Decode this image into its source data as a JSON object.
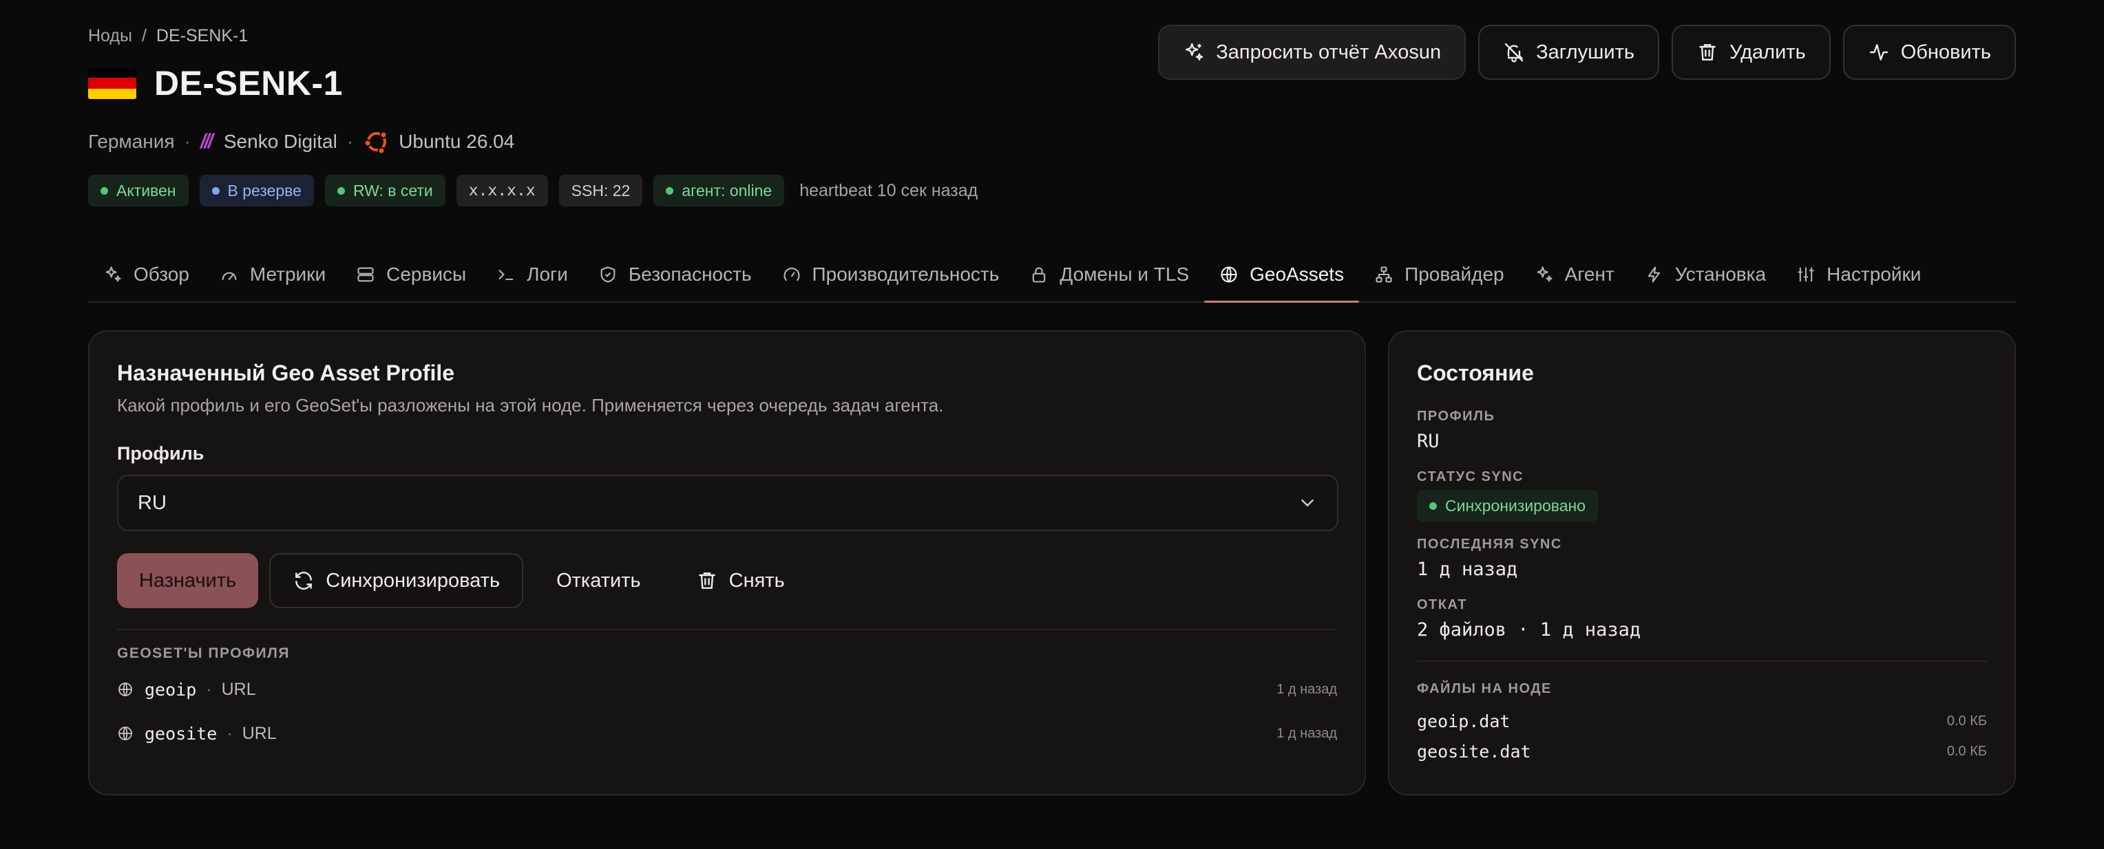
{
  "breadcrumb": {
    "root": "Ноды",
    "separator": "/",
    "current": "DE-SENK-1"
  },
  "node": {
    "title": "DE-SENK-1",
    "flag_colors": [
      "#000000",
      "#dd0000",
      "#ffce00"
    ],
    "country": "Германия",
    "provider_logo": "///",
    "provider": "Senko Digital",
    "os": "Ubuntu 26.04"
  },
  "badges": [
    {
      "label": "Активен",
      "led": "#59c37c"
    },
    {
      "label": "В резерве",
      "led": "#7ea6f5"
    },
    {
      "label": "RW: в сети",
      "led": "#59c37c"
    },
    {
      "label": "x.x.x.x"
    },
    {
      "label": "SSH: 22"
    },
    {
      "label": "агент: online",
      "led": "#59c37c"
    }
  ],
  "heartbeat": "heartbeat 10 сек назад",
  "actions": {
    "request_report": "Запросить отчёт Axosun",
    "mute": "Заглушить",
    "delete": "Удалить",
    "refresh": "Обновить"
  },
  "tabs": [
    {
      "label": "Обзор",
      "icon": "sparkles-icon"
    },
    {
      "label": "Метрики",
      "icon": "gauge-icon"
    },
    {
      "label": "Сервисы",
      "icon": "server-icon"
    },
    {
      "label": "Логи",
      "icon": "terminal-icon"
    },
    {
      "label": "Безопасность",
      "icon": "shield-icon"
    },
    {
      "label": "Производительность",
      "icon": "speedometer-icon"
    },
    {
      "label": "Домены и TLS",
      "icon": "lock-icon"
    },
    {
      "label": "GeoAssets",
      "icon": "globe-icon",
      "active": true
    },
    {
      "label": "Провайдер",
      "icon": "network-icon"
    },
    {
      "label": "Агент",
      "icon": "sparkles-icon"
    },
    {
      "label": "Установка",
      "icon": "bolt-icon"
    },
    {
      "label": "Настройки",
      "icon": "sliders-icon"
    }
  ],
  "profile_card": {
    "title": "Назначенный Geo Asset Profile",
    "description": "Какой профиль и его GeoSet'ы разложены на этой ноде. Применяется через очередь задач агента.",
    "field_label": "Профиль",
    "selected_profile": "RU",
    "assign": "Назначить",
    "sync": "Синхронизировать",
    "rollback": "Откатить",
    "remove": "Снять",
    "geosets_label": "GEOSET'Ы ПРОФИЛЯ",
    "geosets": [
      {
        "name": "geoip",
        "type": "URL",
        "ago": "1 д назад"
      },
      {
        "name": "geosite",
        "type": "URL",
        "ago": "1 д назад"
      }
    ]
  },
  "state_card": {
    "title": "Состояние",
    "profile_label": "ПРОФИЛЬ",
    "profile_value": "RU",
    "sync_status_label": "СТАТУС SYNC",
    "sync_status_value": "Синхронизировано",
    "last_sync_label": "ПОСЛЕДНЯЯ SYNC",
    "last_sync_value": "1 д назад",
    "rollback_label": "ОТКАТ",
    "rollback_value": "2 файлов · 1 д назад",
    "files_label": "ФАЙЛЫ НА НОДЕ",
    "files": [
      {
        "name": "geoip.dat",
        "size": "0.0 КБ"
      },
      {
        "name": "geosite.dat",
        "size": "0.0 КБ"
      }
    ]
  },
  "colors": {
    "accent": "#c67e83",
    "primary_button": "#8a5156",
    "background": "#0b0a0a",
    "card": "#161313"
  }
}
